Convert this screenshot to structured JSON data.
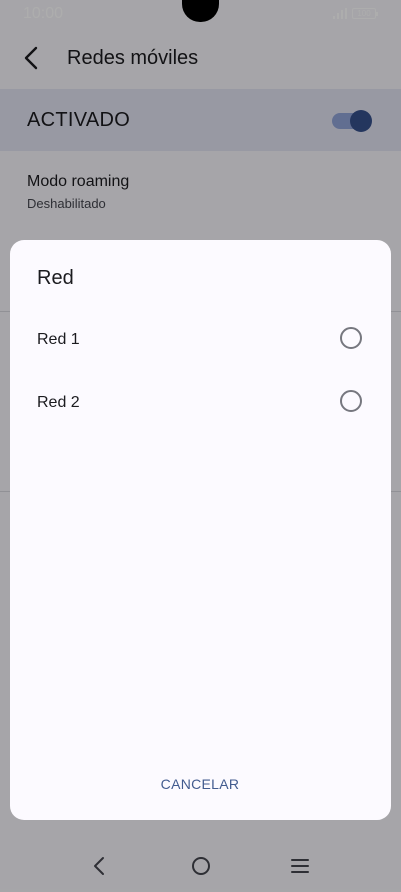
{
  "status_bar": {
    "time": "10:00",
    "battery": "100"
  },
  "app_bar": {
    "title": "Redes móviles"
  },
  "settings": {
    "activated_label": "ACTIVADO",
    "activated_on": true,
    "roaming_title": "Modo roaming",
    "roaming_value": "Deshabilitado"
  },
  "dialog": {
    "title": "Red",
    "options": [
      {
        "label": "Red 1",
        "selected": false
      },
      {
        "label": "Red 2",
        "selected": false
      }
    ],
    "cancel_label": "CANCELAR"
  },
  "colors": {
    "accent": "#36508b",
    "highlight": "#e1e2f0",
    "button_text": "#425b8f"
  },
  "icons": {
    "back": "chevron-left-icon",
    "nav_back": "back-icon",
    "nav_home": "home-icon",
    "nav_menu": "menu-icon"
  }
}
